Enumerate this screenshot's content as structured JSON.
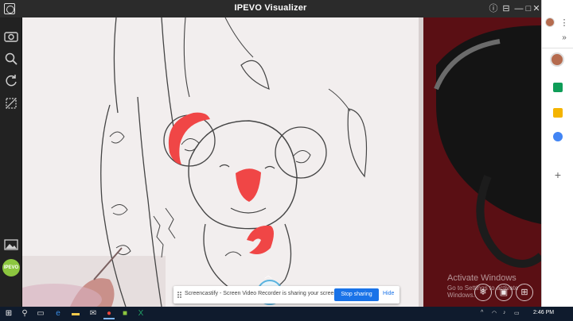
{
  "window": {
    "title": "IPEVO Visualizer",
    "controls": [
      "ⓘ",
      "⊟",
      "—",
      "□",
      "✕"
    ]
  },
  "toolbar": {
    "items": [
      "camera-settings-icon",
      "zoom-icon",
      "rotate-icon",
      "crop-icon",
      "gallery-icon"
    ],
    "badge": "IPEVO"
  },
  "watermark": {
    "line1": "Activate Windows",
    "line2": "Go to Settings to activate Windows."
  },
  "share_bar": {
    "message": "Screencastify - Screen Video Recorder is sharing your screen.",
    "stop_label": "Stop sharing",
    "hide_label": "Hide"
  },
  "chrome_side": {
    "menu": "⋮",
    "expand": "»",
    "plus": "+"
  },
  "taskbar": {
    "time": "2:46 PM",
    "apps": [
      "windows-start-icon",
      "search-icon",
      "task-view-icon",
      "edge-icon",
      "file-explorer-icon",
      "mail-icon",
      "chrome-icon",
      "ipevo-icon",
      "excel-icon"
    ]
  },
  "colors": {
    "accent": "#1a73e8",
    "red_marker": "#f04646",
    "ipevo_green": "#8cc63f"
  }
}
